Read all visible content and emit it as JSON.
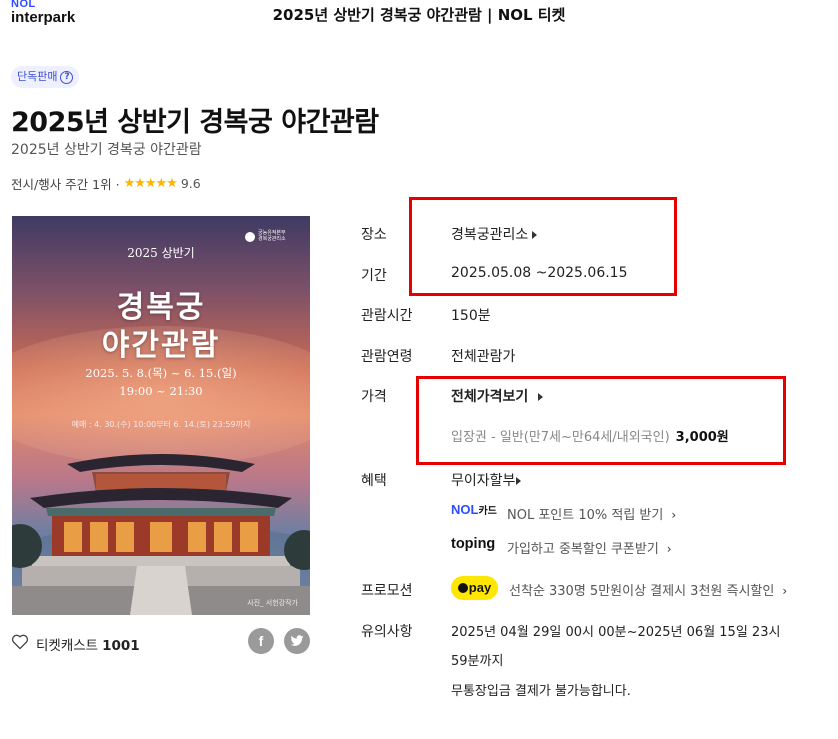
{
  "header": {
    "logo_top": "NOL",
    "logo_bottom": "interpark",
    "page_title": "2025년 상반기 경복궁 야간관람 | NOL 티켓"
  },
  "badge": {
    "label": "단독판매"
  },
  "product": {
    "title": "2025년 상반기 경복궁 야간관람",
    "subtitle": "2025년 상반기 경복궁 야간관람",
    "rank_text": "전시/행사 주간 1위 ·",
    "rating_stars": 5,
    "rating_value": "9.6"
  },
  "poster": {
    "org_line1": "궁능유적본부",
    "org_line2": "경복궁관리소",
    "season": "2025 상반기",
    "title_line1": "경복궁",
    "title_line2": "야간관람",
    "dates": "2025. 5. 8.(목) ~ 6. 15.(일)",
    "time": "19:00 ~ 21:30",
    "presale": "예매 : 4. 30.(수) 10:00부터 6. 14.(토) 23:59까지",
    "credit": "사진_ 서헌강작가"
  },
  "info": {
    "venue_label": "장소",
    "venue_value": "경복궁관리소",
    "period_label": "기간",
    "period_value": "2025.05.08 ~2025.06.15",
    "runtime_label": "관람시간",
    "runtime_value": "150분",
    "age_label": "관람연령",
    "age_value": "전체관람가",
    "price_label": "가격",
    "price_all_link": "전체가격보기",
    "price_item": "입장권 - 일반(만7세~만64세/내외국인)",
    "price_amount": "3,000원",
    "benefit_label": "혜택",
    "benefit_installment": "무이자할부",
    "nol_card_logo": "NOL",
    "nol_card_logo_suffix": "카드",
    "nol_card_text": "NOL 포인트 10% 적립 받기",
    "toping_logo": "toping",
    "toping_text": "가입하고 중복할인 쿠폰받기",
    "promo_label": "프로모션",
    "pay_badge": "pay",
    "promo_text": "선착순 330명 5만원이상 결제시 3천원 즉시할인",
    "notice_label": "유의사항",
    "notice_line1": "2025년 04월 29일 00시 00분~2025년 06월 15일 23시",
    "notice_line2": "59분까지",
    "notice_line3": "무통장입금 결제가 불가능합니다."
  },
  "actions": {
    "ticketcast_label": "티켓캐스트",
    "ticketcast_count": "1001",
    "facebook_icon": "facebook-icon",
    "twitter_icon": "twitter-icon"
  },
  "colors": {
    "highlight_box": "#e60000",
    "star": "#ffb400",
    "brand_blue": "#2f4cff",
    "kakaopay_yellow": "#ffe600"
  }
}
